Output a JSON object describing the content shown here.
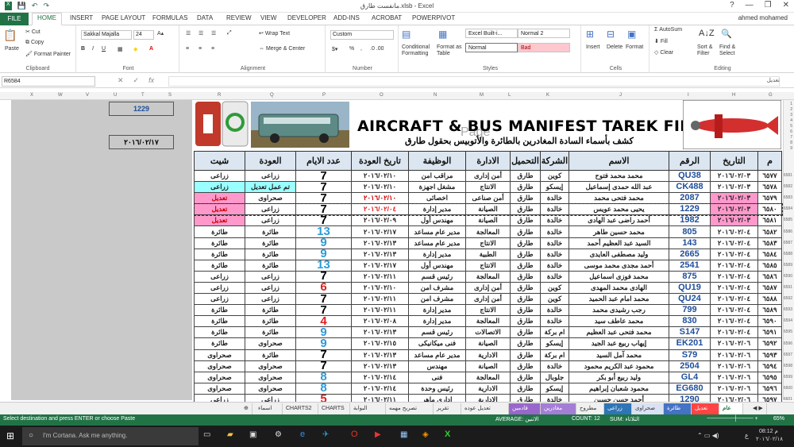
{
  "window": {
    "title": "مانفست طارق.xlsb - Excel",
    "controls": [
      "?",
      "—",
      "❐",
      "✕"
    ]
  },
  "ribbon_tabs": [
    "FILE",
    "HOME",
    "INSERT",
    "PAGE LAYOUT",
    "FORMULAS",
    "DATA",
    "REVIEW",
    "VIEW",
    "DEVELOPER",
    "ADD-INS",
    "ACROBAT",
    "POWERPIVOT"
  ],
  "user_name": "ahmed mohamed",
  "ribbon": {
    "paste": "Paste",
    "cut": "Cut",
    "copy": "Copy",
    "format_painter": "Format Painter",
    "clipboard": "Clipboard",
    "font_name": "Sakkal Majalla",
    "font_size": "24",
    "font": "Font",
    "wrap_text": "Wrap Text",
    "merge_center": "Merge & Center",
    "alignment": "Alignment",
    "number_format": "Custom",
    "number": "Number",
    "conditional_formatting": "Conditional Formatting",
    "format_as_table": "Format as Table",
    "style_builtin": "Excel Built-i...",
    "style_normal2": "Normal 2",
    "style_normal": "Normal",
    "style_bad": "Bad",
    "styles": "Styles",
    "insert": "Insert",
    "delete": "Delete",
    "format": "Format",
    "cells": "Cells",
    "autosum": "AutoSum",
    "fill": "Fill",
    "clear": "Clear",
    "sort_filter": "Sort & Filter",
    "find_select": "Find & Select",
    "editing": "Editing",
    "colors": {
      "bad_bg": "#ffc7ce",
      "bad_fg": "#9c0006",
      "accent": "#217346"
    }
  },
  "formula_bar": {
    "name_box": "R6584",
    "right_label": "تعديل"
  },
  "column_letters": [
    "X",
    "W",
    "V",
    "U",
    "T",
    "S",
    "R",
    "Q",
    "P",
    "O",
    "N",
    "M",
    "L",
    "K",
    "J",
    "I",
    "H",
    "G"
  ],
  "row_numbers": [
    "1",
    "2",
    "3",
    "4",
    "5",
    "6",
    "7",
    "8",
    "9",
    "6581",
    "6582",
    "6583",
    "6584",
    "6585",
    "6586",
    "6587",
    "6588",
    "6589",
    "6590",
    "6591",
    "6592",
    "6593",
    "6594",
    "6595",
    "6596",
    "6597",
    "6598",
    "6599",
    "6600",
    "6601",
    "6602",
    "6603"
  ],
  "side_boxes": {
    "number": "1229",
    "date": "٢٠١٦/٠٢/١٧"
  },
  "banner": {
    "title": "AIRCRAFT & BUS MANIFEST TAREK FIEL",
    "subtitle": "كشف بأسماء السادة المغادرين بالطائرة والأتوبيس بحقول طارق",
    "page_watermark": "Page"
  },
  "headers": [
    "شيت",
    "العودة",
    "عدد الايام",
    "تاريخ العودة",
    "الوظيفة",
    "الادارة",
    "التحميل",
    "الشركة",
    "الاسم",
    "الرقم",
    "التاريخ",
    "م"
  ],
  "rows": [
    {
      "sheet": "زراعى",
      "ret": "زراعى",
      "days": "7",
      "rdate": "٢٠١٦/٠٢/١٠",
      "job": "مراقب امن",
      "dept": "أمن إدارى",
      "load": "طارق",
      "co": "كوين",
      "name": "محمد محمد فتوح",
      "num": "QU38",
      "date": "٢٠١٦/٠٢/٠٣",
      "m": "٦٥٧٧",
      "mark": ""
    },
    {
      "sheet": "زراعى",
      "ret": "تم عمل تعديل",
      "days": "7",
      "rdate": "٢٠١٦/٠٢/١٠",
      "job": "مشغل اجهزة",
      "dept": "الانتاج",
      "load": "طارق",
      "co": "إيسكو",
      "name": "عبد الله حمدى إسماعيل",
      "num": "CK488",
      "date": "٢٠١٦/٠٢/٠٣",
      "m": "٦٥٧٨",
      "mark": "cyan"
    },
    {
      "sheet": "تعديل",
      "ret": "صحراوى",
      "days": "7",
      "rdate": "٢٠١٦/٠٢/١٠",
      "job": "اخصائى",
      "dept": "أمن صناعى",
      "load": "طارق",
      "co": "خالدة",
      "name": "محمد فتحى محمد",
      "num": "2087",
      "date": "٢٠١٦/٠٢/٠٣",
      "m": "٦٥٧٩",
      "mark": "pink"
    },
    {
      "sheet": "تعديل",
      "ret": "زراعى",
      "days": "7",
      "rdate": "٢٠١٦/٠٢/٠٤",
      "job": "مدير إدارة",
      "dept": "الصيانة",
      "load": "طارق",
      "co": "خالدة",
      "name": "يحيى محمد عويس",
      "num": "1229",
      "date": "٢٠١٦/٠٢/٠٣",
      "m": "٦٥٨٠",
      "mark": "pink"
    },
    {
      "sheet": "تعديل",
      "ret": "زراعى",
      "days": "7",
      "rdate": "٢٠١٦/٠٢/٠٩",
      "job": "مهندس أول",
      "dept": "الصيانة",
      "load": "طارق",
      "co": "خالدة",
      "name": "أحمد راضى عبد الهادى",
      "num": "1982",
      "date": "٢٠١٦/٠٢/٠٣",
      "m": "٦٥٨١",
      "mark": "pink"
    },
    {
      "sheet": "طائرة",
      "ret": "طائرة",
      "days": "13",
      "rdate": "٢٠١٦/٠٢/١٧",
      "job": "مدير عام مساعد",
      "dept": "المعالجة",
      "load": "طارق",
      "co": "خالدة",
      "name": "محمد حسين طاهر",
      "num": "805",
      "date": "٢٠١٦/٠٢/٠٤",
      "m": "٦٥٨٢",
      "mark": ""
    },
    {
      "sheet": "طائرة",
      "ret": "طائرة",
      "days": "9",
      "rdate": "٢٠١٦/٠٢/١٣",
      "job": "مدير عام مساعد",
      "dept": "الانتاج",
      "load": "طارق",
      "co": "خالدة",
      "name": "السيد عبد العظيم أحمد",
      "num": "143",
      "date": "٢٠١٦/٠٢/٠٤",
      "m": "٦٥٨٣",
      "mark": ""
    },
    {
      "sheet": "طائرة",
      "ret": "طائرة",
      "days": "9",
      "rdate": "٢٠١٦/٠٢/١٣",
      "job": "مدير إدارة",
      "dept": "الطبية",
      "load": "طارق",
      "co": "خالدة",
      "name": "وليد مصطفى العايدى",
      "num": "2665",
      "date": "٢٠١٦/٠٢/٠٤",
      "m": "٦٥٨٤",
      "mark": ""
    },
    {
      "sheet": "طائرة",
      "ret": "طائرة",
      "days": "13",
      "rdate": "٢٠١٦/٠٢/١٧",
      "job": "مهندس أول",
      "dept": "الانتاج",
      "load": "طارق",
      "co": "خالدة",
      "name": "أحمد مجدى محمد موسى",
      "num": "2541",
      "date": "٢٠١٦/٠٢/٠٤",
      "m": "٦٥٨٥",
      "mark": ""
    },
    {
      "sheet": "زراعى",
      "ret": "زراعى",
      "days": "7",
      "rdate": "٢٠١٦/٠٢/١١",
      "job": "رئيس قسم",
      "dept": "المعالجة",
      "load": "طارق",
      "co": "خالدة",
      "name": "محمد فوزى اسماعيل",
      "num": "875",
      "date": "٢٠١٦/٠٢/٠٤",
      "m": "٦٥٨٦",
      "mark": ""
    },
    {
      "sheet": "زراعى",
      "ret": "زراعى",
      "days": "6",
      "rdate": "٢٠١٦/٠٢/١٠",
      "job": "مشرف امن",
      "dept": "أمن إدارى",
      "load": "طارق",
      "co": "كوين",
      "name": "الهادى محمد المهدى",
      "num": "QU19",
      "date": "٢٠١٦/٠٢/٠٤",
      "m": "٦٥٨٧",
      "mark": ""
    },
    {
      "sheet": "زراعى",
      "ret": "زراعى",
      "days": "7",
      "rdate": "٢٠١٦/٠٢/١١",
      "job": "مشرف امن",
      "dept": "أمن إدارى",
      "load": "طارق",
      "co": "كوين",
      "name": "محمد امام عبد الحميد",
      "num": "QU24",
      "date": "٢٠١٦/٠٢/٠٤",
      "m": "٦٥٨٨",
      "mark": ""
    },
    {
      "sheet": "طائرة",
      "ret": "طائرة",
      "days": "7",
      "rdate": "٢٠١٦/٠٢/١١",
      "job": "مدير إدارة",
      "dept": "الانتاج",
      "load": "طارق",
      "co": "خالدة",
      "name": "رجب رشيدى محمد",
      "num": "799",
      "date": "٢٠١٦/٠٢/٠٤",
      "m": "٦٥٨٩",
      "mark": ""
    },
    {
      "sheet": "طائرة",
      "ret": "طائرة",
      "days": "4",
      "rdate": "٢٠١٦/٠٢/٠٨",
      "job": "مدير إدارة",
      "dept": "المعالجة",
      "load": "طارق",
      "co": "خالدة",
      "name": "محمد عاطف سيد",
      "num": "830",
      "date": "٢٠١٦/٠٢/٠٤",
      "m": "٦٥٩٠",
      "mark": ""
    },
    {
      "sheet": "طائرة",
      "ret": "طائرة",
      "days": "9",
      "rdate": "٢٠١٦/٠٢/١٣",
      "job": "رئيس قسم",
      "dept": "الاتصالات",
      "load": "طارق",
      "co": "ام بركة",
      "name": "محمد فتحى عبد العظيم",
      "num": "S147",
      "date": "٢٠١٦/٠٢/٠٤",
      "m": "٦٥٩١",
      "mark": ""
    },
    {
      "sheet": "طائرة",
      "ret": "صحراوى",
      "days": "9",
      "rdate": "٢٠١٦/٠٢/١٥",
      "job": "فنى ميكانيكى",
      "dept": "الصيانة",
      "load": "طارق",
      "co": "إيسكو",
      "name": "إيهاب ربيع عبد الجيد",
      "num": "EK201",
      "date": "٢٠١٦/٠٢/٠٦",
      "m": "٦٥٩٢",
      "mark": ""
    },
    {
      "sheet": "صحراوى",
      "ret": "طائرة",
      "days": "7",
      "rdate": "٢٠١٦/٠٢/١٣",
      "job": "مدير عام مساعد",
      "dept": "الادارية",
      "load": "طارق",
      "co": "ام بركة",
      "name": "محمد آمل السيد",
      "num": "S79",
      "date": "٢٠١٦/٠٢/٠٦",
      "m": "٦٥٩٣",
      "mark": ""
    },
    {
      "sheet": "صحراوى",
      "ret": "صحراوى",
      "days": "7",
      "rdate": "٢٠١٦/٠٢/١٣",
      "job": "مهندس",
      "dept": "الصيانة",
      "load": "طارق",
      "co": "خالدة",
      "name": "محمود عبد الكريم محمود",
      "num": "2504",
      "date": "٢٠١٦/٠٢/٠٦",
      "m": "٦٥٩٤",
      "mark": ""
    },
    {
      "sheet": "صحراوى",
      "ret": "صحراوى",
      "days": "8",
      "rdate": "٢٠١٦/٠٢/١٤",
      "job": "فنى",
      "dept": "المعالجة",
      "load": "طارق",
      "co": "جلوبال",
      "name": "وليد ربيع أبو بكر",
      "num": "GL4",
      "date": "٢٠١٦/٠٢/٠٦",
      "m": "٦٥٩٥",
      "mark": ""
    },
    {
      "sheet": "صحراوى",
      "ret": "صحراوى",
      "days": "8",
      "rdate": "٢٠١٦/٠٢/١٤",
      "job": "رئيس وحدة",
      "dept": "الادارية",
      "load": "طارق",
      "co": "إيسكو",
      "name": "محمود شعبان إبراهيم",
      "num": "EG680",
      "date": "٢٠١٦/٠٢/٠٦",
      "m": "٦٥٩٦",
      "mark": ""
    },
    {
      "sheet": "زراعى",
      "ret": "زراعى",
      "days": "5",
      "rdate": "٢٠١٦/٠٢/١١",
      "job": "ادارى ماهر",
      "dept": "الادارية",
      "load": "طارق",
      "co": "خالدة",
      "name": "أحمد حسن حسين",
      "num": "1290",
      "date": "٢٠١٦/٠٢/٠٦",
      "m": "٦٥٩٧",
      "mark": ""
    }
  ],
  "sheet_tabs": [
    "عام",
    "تعديل",
    "طائرة",
    "صحراوى",
    "زراعى",
    "مطروح",
    "مغادرين",
    "قادمين",
    "تعديل عوده",
    "تقرير",
    "تصريح مهمه",
    "البوابة",
    "CHARTS",
    "CHARTS2",
    "اسماء"
  ],
  "status": {
    "left": "Select destination and press ENTER or choose Paste",
    "average": "AVERAGE: الاثنين",
    "count": "COUNT: 12",
    "sum": "SUM: الثلاثاء",
    "zoom": "65%"
  },
  "taskbar": {
    "cortana": "I'm Cortana. Ask me anything.",
    "time": "08:12 م",
    "date": "٢٠١٦/٠٢/١٨",
    "lang": "ع"
  }
}
